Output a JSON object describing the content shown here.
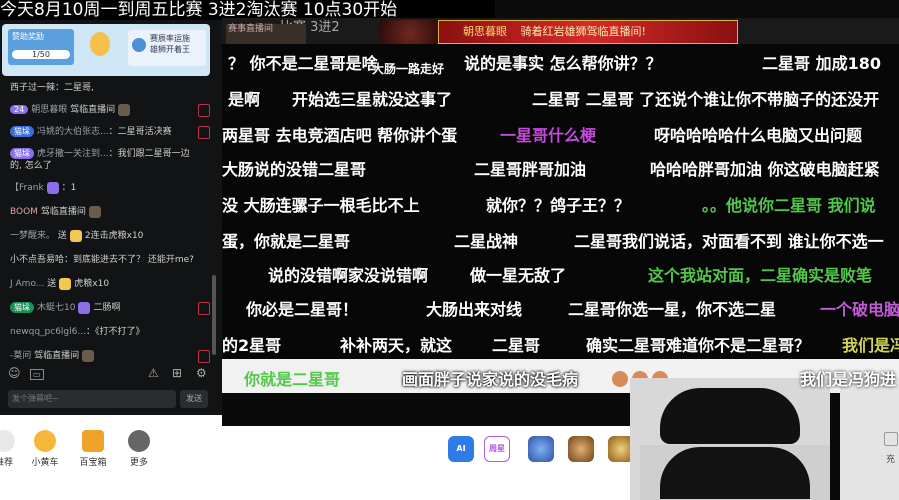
{
  "top_banner": "今天8月10周一到周五比赛   3进2淘汰赛  10点30开始",
  "subtitle_fragment": "比赛   3进2",
  "live_tag": "赛事直播间",
  "red_banner": {
    "tag": "朝思暮眼",
    "text": "骑着红岩雄狮驾临直播间!"
  },
  "left_panel": {
    "card_left_title": "赞助奖励",
    "card_left_progress": "1/50",
    "card_right_title": "赛辰率运施",
    "card_right_sub": "雄狮开着王",
    "chat": [
      {
        "name": "",
        "text": "西子过一辣：二星哥,"
      },
      {
        "badge": "24",
        "badge_color": "purple",
        "name": "朝思暮眼",
        "text": "驾临直播间"
      },
      {
        "badge": "猫垛",
        "badge_color": "blue",
        "name": "冯姚的大伯张志...",
        "text": "：二星哥活决赛"
      },
      {
        "badge": "猫垛",
        "badge_color": "purple",
        "name": "虎牙撒一关注到...",
        "text": "：我们跟二星哥一边"
      },
      {
        "name": "",
        "text": "的, 怎么了"
      },
      {
        "name": "【Frank",
        "text": "：1"
      },
      {
        "name": "BOOM",
        "text": "驾临直播间"
      },
      {
        "name": "一梦醒来。",
        "text": "送",
        "gift": "2连击虎粮x10"
      },
      {
        "name": "",
        "text": "小不点吾易哈：到底能进去不了？ 还能开me?"
      },
      {
        "name": "J  Amo...",
        "text": "送",
        "gift": "虎粮x10"
      },
      {
        "badge": "猫垛",
        "badge_color": "green",
        "name": "木蜓七10",
        "text": "二肠啊"
      },
      {
        "name": "newqq_pc6lgl6...",
        "text": "：《打不打了》"
      },
      {
        "name": "-莫问",
        "text": "驾临直播间"
      }
    ],
    "input_placeholder": "发个弹幕吧~",
    "send_label": "发送"
  },
  "danmaku": [
    {
      "t": "？  你不是二星哥是啥",
      "c": "white"
    },
    {
      "t": "大肠一路走好",
      "c": "white"
    },
    {
      "t": "说的是事实   怎么帮你讲？？",
      "c": "white"
    },
    {
      "t": "二星哥   加成180",
      "c": "white"
    },
    {
      "t": "开始选三星就没这事了",
      "c": "white"
    },
    {
      "t": "二星哥   二星哥 了还说个谁让你不带脑子的还没开",
      "c": "white"
    },
    {
      "t": "是啊",
      "c": "white"
    },
    {
      "t": "两星哥   去电竞酒店吧   帮你讲个蛋",
      "c": "white"
    },
    {
      "t": "一星哥什么梗",
      "c": "pink"
    },
    {
      "t": "呀哈哈哈哈什么电脑又出问题",
      "c": "white"
    },
    {
      "t": "大肠说的没错二星哥",
      "c": "white"
    },
    {
      "t": "二星哥胖哥加油",
      "c": "white"
    },
    {
      "t": "哈哈哈胖哥加油   你这破电脑赶紧",
      "c": "white"
    },
    {
      "t": "没   大肠连骡子一根毛比不上",
      "c": "white"
    },
    {
      "t": "就你？？鸽子王？？",
      "c": "white"
    },
    {
      "t": "。。他说你二星哥   我们说",
      "c": "green"
    },
    {
      "t": "蛋，你就是二星哥",
      "c": "white"
    },
    {
      "t": "二星战神",
      "c": "white"
    },
    {
      "t": "二星哥我们说话，对面看不到 谁让你不选一",
      "c": "white"
    },
    {
      "t": "说的没错啊家没说错啊",
      "c": "white"
    },
    {
      "t": "做一星无敌了",
      "c": "white"
    },
    {
      "t": "这个我站对面，二星确实是败笔",
      "c": "green"
    },
    {
      "t": "你必是二星哥！",
      "c": "white"
    },
    {
      "t": "大肠出来对线",
      "c": "white"
    },
    {
      "t": "二星哥你选一星，你不选二星",
      "c": "white"
    },
    {
      "t": "一个破电脑",
      "c": "purple"
    },
    {
      "t": "的2星哥",
      "c": "white"
    },
    {
      "t": "补补两天，就这",
      "c": "white"
    },
    {
      "t": "二星哥",
      "c": "white"
    },
    {
      "t": "确实二星哥难道你不是二星哥？",
      "c": "white"
    },
    {
      "t": "我们是冯",
      "c": "yellow"
    }
  ],
  "strip": {
    "green": "你就是二星哥",
    "overlay": "画面胖子说家说的没毛病",
    "right": "我们是冯狗进"
  },
  "bottom_nav": [
    {
      "label": "推荐"
    },
    {
      "label": "小黄车"
    },
    {
      "label": "百宝箱"
    },
    {
      "label": "更多"
    }
  ],
  "toolbar_icons": [
    {
      "label": "AI"
    },
    {
      "label": "周星"
    }
  ],
  "right_text": "充"
}
